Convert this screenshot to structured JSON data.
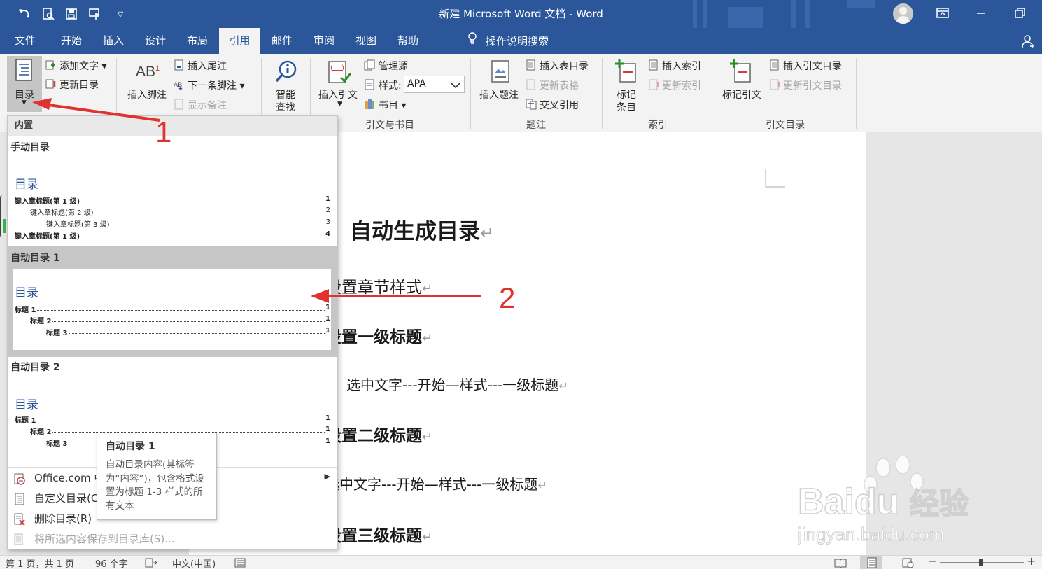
{
  "window": {
    "title": "新建 Microsoft Word 文档  -  Word",
    "colors": {
      "brand": "#2b579a",
      "annotation": "#e0322e",
      "toc_heading": "#2f5597"
    },
    "qat_icons": [
      "undo-icon",
      "print-preview-icon",
      "save-icon",
      "touch-mode-icon",
      "customize-qat-icon"
    ]
  },
  "tabs": [
    "文件",
    "开始",
    "插入",
    "设计",
    "布局",
    "引用",
    "邮件",
    "审阅",
    "视图",
    "帮助"
  ],
  "active_tab": "引用",
  "tell_me": "操作说明搜索",
  "ribbon": {
    "toc": {
      "big": "目录",
      "add_text": "添加文字",
      "update": "更新目录"
    },
    "footnotes": {
      "insert_footnote": "插入脚注",
      "insert_endnote": "插入尾注",
      "next_footnote": "下一条脚注",
      "show_notes": "显示备注",
      "ab_glyph": "AB",
      "ab_sup": "1"
    },
    "research": {
      "smart_lookup_1": "智能",
      "smart_lookup_2": "查找"
    },
    "citations": {
      "insert_citation": "插入引文",
      "manage_sources": "管理源",
      "style_label": "样式:",
      "style_value": "APA",
      "bibliography": "书目",
      "group": "引文与书目"
    },
    "captions": {
      "insert_caption": "插入题注",
      "insert_tof": "插入表目录",
      "update_table": "更新表格",
      "cross_ref": "交叉引用",
      "group": "题注"
    },
    "index": {
      "mark_entry_1": "标记",
      "mark_entry_2": "条目",
      "insert_index": "插入索引",
      "update_index": "更新索引",
      "group": "索引"
    },
    "toa": {
      "mark_citation": "标记引文",
      "insert_toa": "插入引文目录",
      "update_toa": "更新引文目录",
      "group": "引文目录"
    }
  },
  "gallery": {
    "section_builtin": "内置",
    "manual": {
      "title": "手动目录",
      "heading": "目录",
      "lines": [
        {
          "text": "键入章标题(第 1 级)",
          "page": "1",
          "level": 1
        },
        {
          "text": "键入章标题(第 2 级)",
          "page": "2",
          "level": 2
        },
        {
          "text": "键入章标题(第 3 级)",
          "page": "3",
          "level": 3
        },
        {
          "text": "键入章标题(第 1 级)",
          "page": "4",
          "level": 1
        }
      ]
    },
    "auto1": {
      "title": "自动目录 1",
      "heading": "目录",
      "lines": [
        {
          "text": "标题 1",
          "page": "1",
          "level": 1
        },
        {
          "text": "标题 2",
          "page": "1",
          "level": 2
        },
        {
          "text": "标题 3",
          "page": "1",
          "level": 3
        }
      ]
    },
    "auto2": {
      "title": "自动目录 2",
      "heading": "目录",
      "lines": [
        {
          "text": "标题 1",
          "page": "1",
          "level": 1
        },
        {
          "text": "标题 2",
          "page": "1",
          "level": 2
        },
        {
          "text": "标题 3",
          "page": "1",
          "level": 3
        }
      ]
    },
    "menu": [
      {
        "label": "Office.com 中的其他目录(M)",
        "icon": "office-toc-icon",
        "submenu": true,
        "disabled": false
      },
      {
        "label": "自定义目录(C)...",
        "icon": "custom-toc-icon",
        "submenu": false,
        "disabled": false
      },
      {
        "label": "删除目录(R)",
        "icon": "remove-toc-icon",
        "submenu": false,
        "disabled": false
      },
      {
        "label": "将所选内容保存到目录库(S)...",
        "icon": "save-selection-icon",
        "submenu": false,
        "disabled": true
      }
    ],
    "tooltip": {
      "title": "自动目录 1",
      "body": "自动目录内容(其标签为“内容”)，包含格式设置为标题 1-3 样式的所有文本"
    }
  },
  "document": {
    "title": "自动生成目录",
    "para_mark": "↵",
    "lines": [
      "设置章节样式",
      "设置一级标题",
      "选中文字---开始—样式---一级标题",
      "设置二级标题",
      "选中文字---开始—样式---一级标题",
      "设置三级标题"
    ]
  },
  "annotations": {
    "label_1": "1",
    "label_2": "2"
  },
  "watermark": {
    "brand": "Baidu",
    "cn": "经验",
    "url": "jingyan.baidu.com"
  },
  "status": {
    "page": "第 1 页，共 1 页",
    "words": "96 个字",
    "language": "中文(中国)"
  }
}
